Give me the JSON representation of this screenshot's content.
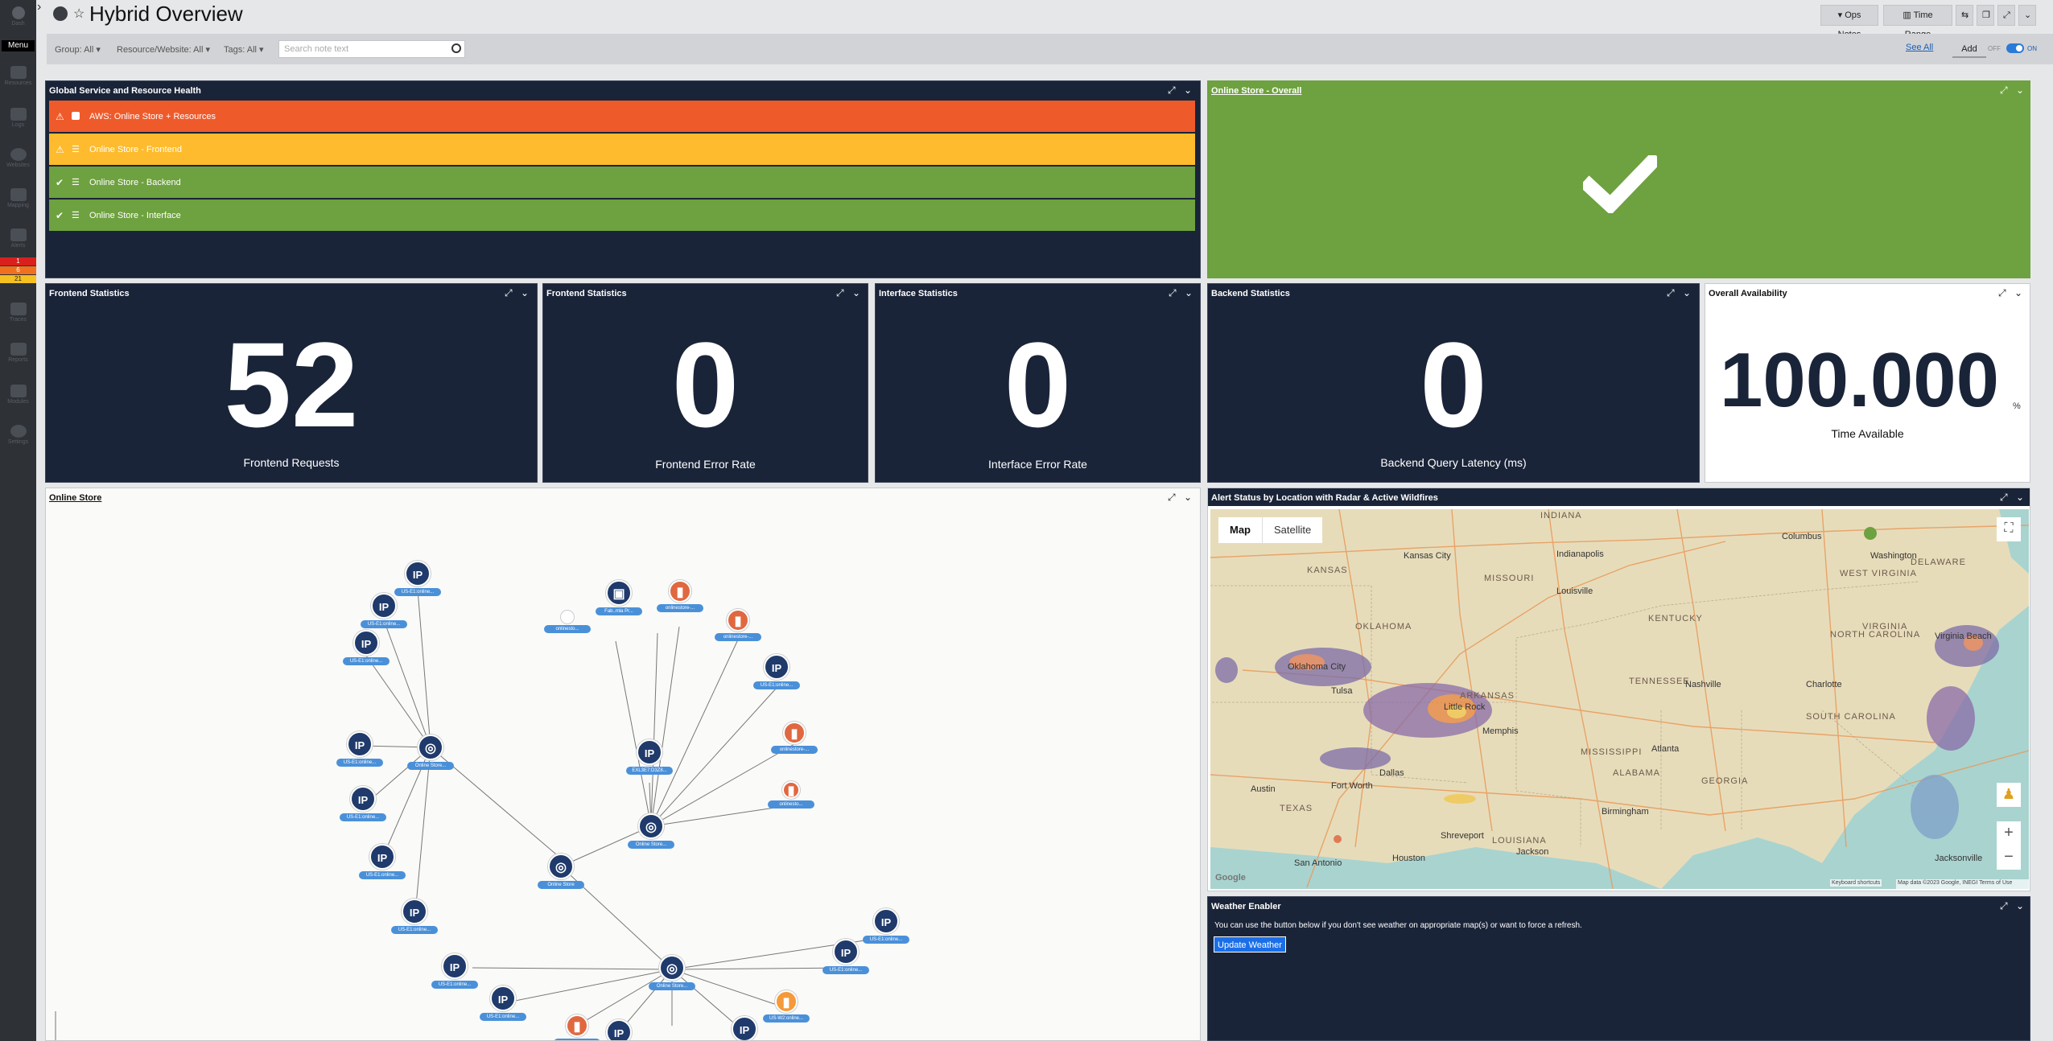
{
  "sidebar": {
    "dash_label": "Dash",
    "menu_label": "Menu",
    "items": [
      {
        "label": "Resources",
        "icon": "server-icon"
      },
      {
        "label": "Logs",
        "icon": "log-icon"
      },
      {
        "label": "Websites",
        "icon": "globe-icon"
      },
      {
        "label": "Mapping",
        "icon": "topology-icon"
      },
      {
        "label": "Alerts",
        "icon": "alert-icon"
      },
      {
        "label": "Traces",
        "icon": "trace-icon"
      },
      {
        "label": "Reports",
        "icon": "report-icon"
      },
      {
        "label": "Modules",
        "icon": "module-icon"
      },
      {
        "label": "Settings",
        "icon": "gear-icon"
      }
    ],
    "alert_counts": [
      "1",
      "6",
      "21"
    ]
  },
  "header": {
    "title": "Hybrid Overview",
    "ops_notes": "Ops Notes",
    "time_range": "Time Range"
  },
  "filters": {
    "group": "Group: All",
    "resource": "Resource/Website: All",
    "tags": "Tags: All",
    "search_placeholder": "Search note text",
    "see_all": "See All",
    "add": "Add",
    "toggle_off": "OFF",
    "toggle_on": "ON"
  },
  "health": {
    "title": "Global Service and Resource Health",
    "rows": [
      {
        "label": "AWS: Online Store + Resources",
        "color": "#ef5a2a",
        "status": "warning"
      },
      {
        "label": "Online Store - Frontend",
        "color": "#fdbb2d",
        "status": "warning"
      },
      {
        "label": "Online Store - Backend",
        "color": "#6ea13f",
        "status": "ok"
      },
      {
        "label": "Online Store - Interface",
        "color": "#6ea13f",
        "status": "ok"
      }
    ]
  },
  "overall": {
    "title": "Online Store - Overall",
    "color": "#6ea13f"
  },
  "stats": [
    {
      "title": "Frontend Statistics",
      "value": "52",
      "label": "Frontend Requests"
    },
    {
      "title": "Frontend Statistics",
      "value": "0",
      "label": "Frontend Error Rate"
    },
    {
      "title": "Interface Statistics",
      "value": "0",
      "label": "Interface Error Rate"
    },
    {
      "title": "Backend Statistics",
      "value": "0",
      "label": "Backend Query Latency (ms)"
    }
  ],
  "availability": {
    "title": "Overall Availability",
    "value": "100.000",
    "unit": "%",
    "label": "Time Available"
  },
  "topology": {
    "title": "Online Store",
    "ip_label": "IP",
    "node_labels": {
      "us_e1": "US-E1:online...",
      "us_w2": "US-W2:online...",
      "store": "Online Store...",
      "store_short": "Online Store",
      "ip_ec2": "EXL3E7:D3Z8...",
      "fabric": "Fab..mla Pr...",
      "onl_store": "onlinestore-...",
      "sub": "onlinesto...",
      "mini": "onlinesto..."
    }
  },
  "map": {
    "title": "Alert Status by Location with Radar & Active Wildfires",
    "tab_map": "Map",
    "tab_satellite": "Satellite",
    "states": [
      "INDIANA",
      "KANSAS",
      "MISSOURI",
      "KENTUCKY",
      "WEST VIRGINIA",
      "OKLAHOMA",
      "ARKANSAS",
      "TENNESSEE",
      "NORTH CAROLINA",
      "SOUTH CAROLINA",
      "MISSISSIPPI",
      "ALABAMA",
      "GEORGIA",
      "TEXAS",
      "LOUISIANA",
      "DELAWARE",
      "VIRGINIA"
    ],
    "cities": [
      "Kansas City",
      "Indianapolis",
      "Columbus",
      "Louisville",
      "Nashville",
      "Dallas",
      "Fort Worth",
      "Atlanta",
      "Charlotte",
      "Houston",
      "San Antonio",
      "Jacksonville",
      "Memphis",
      "Little Rock",
      "Oklahoma City",
      "Tulsa",
      "Birmingham",
      "Jackson",
      "Shreveport",
      "Austin",
      "Virginia Beach",
      "Washington"
    ],
    "footer_keyboard": "Keyboard shortcuts",
    "footer_data": "Map data ©2023 Google, INEGI",
    "footer_terms": "Terms of Use",
    "google": "Google"
  },
  "weather": {
    "title": "Weather Enabler",
    "text": "You can use the button below if you don't see weather on appropriate map(s) or want to force a refresh.",
    "button": "Update Weather"
  }
}
